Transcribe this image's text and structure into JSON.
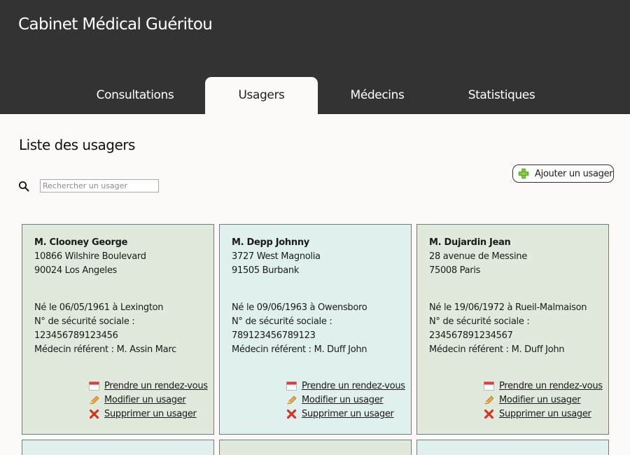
{
  "header": {
    "site_title": "Cabinet Médical Guéritou",
    "tabs": [
      {
        "label": "Consultations",
        "active": false
      },
      {
        "label": "Usagers",
        "active": true
      },
      {
        "label": "Médecins",
        "active": false
      },
      {
        "label": "Statistiques",
        "active": false
      }
    ]
  },
  "main": {
    "title": "Liste des usagers",
    "search": {
      "placeholder": "Rechercher un usager",
      "value": ""
    },
    "add_button_label": "Ajouter un usager",
    "actions": {
      "appointment": "Prendre un rendez-vous",
      "edit": "Modifier un usager",
      "delete": "Supprimer un usager"
    },
    "patients": [
      {
        "name": "M. Clooney George",
        "address_line1": "10866 Wilshire Boulevard",
        "address_line2": "90024 Los Angeles",
        "birth": "Né le 06/05/1961 à Lexington",
        "ssn_label": "N° de sécurité sociale :",
        "ssn": "123456789123456",
        "doctor": "Médecin référent : M. Assin Marc"
      },
      {
        "name": "M. Depp Johnny",
        "address_line1": "3727 West Magnolia",
        "address_line2": "91505 Burbank",
        "birth": "Né le 09/06/1963 à Owensboro",
        "ssn_label": "N° de sécurité sociale :",
        "ssn": "789123456789123",
        "doctor": "Médecin référent : M. Duff John"
      },
      {
        "name": "M. Dujardin Jean",
        "address_line1": "28 avenue de Messine",
        "address_line2": "75008 Paris",
        "birth": "Né le 19/06/1972 à Rueil-Malmaison",
        "ssn_label": "N° de sécurité sociale :",
        "ssn": "234567891234567",
        "doctor": "Médecin référent : M. Duff John"
      }
    ]
  },
  "colors": {
    "header_bg": "#333333",
    "page_bg": "#fcf9f8",
    "card_green": "#e1e9dc",
    "card_blue": "#dff0ee"
  },
  "icons": {
    "search": "search-icon",
    "add": "plus-icon",
    "appointment": "calendar-icon",
    "edit": "pencil-icon",
    "delete": "cross-icon"
  }
}
